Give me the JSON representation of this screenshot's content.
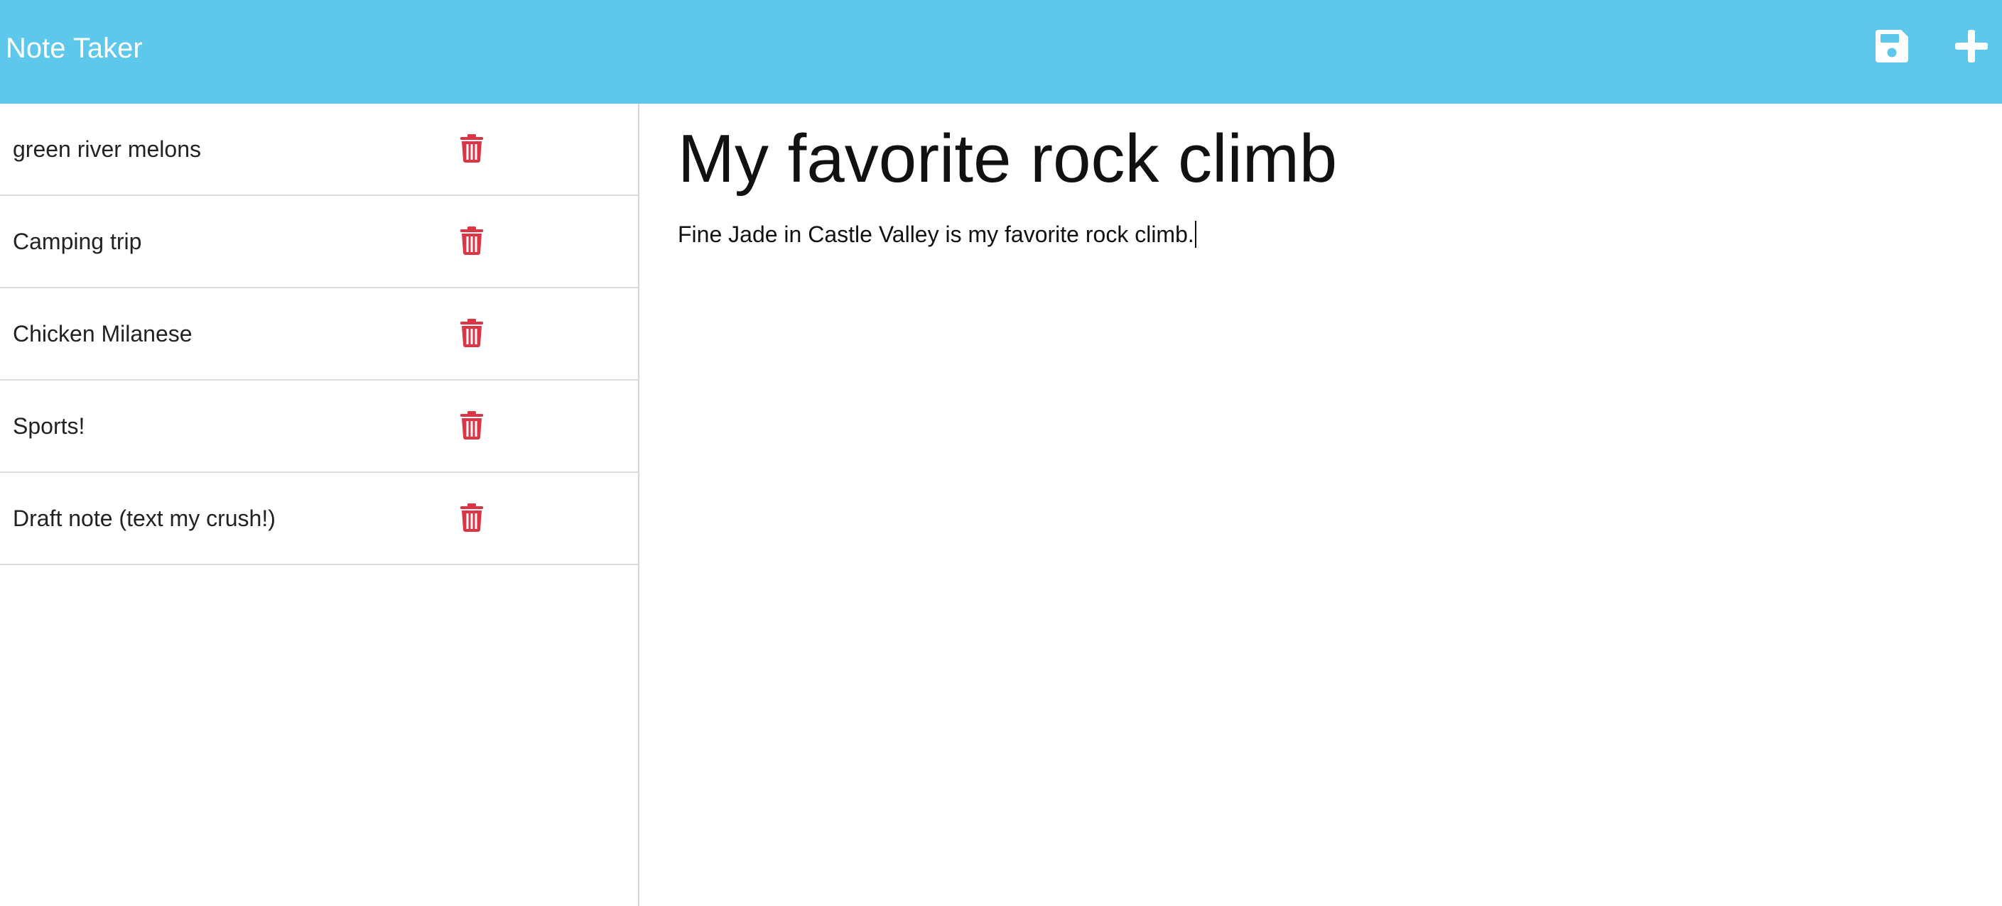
{
  "app": {
    "brand": "Note Taker"
  },
  "toolbar": {
    "save_icon": "floppy-disk-icon",
    "new_icon": "plus-icon",
    "icon_color": "#ffffff"
  },
  "colors": {
    "navbar": "#5ec8ec",
    "delete": "#dc3545"
  },
  "sidebar": {
    "notes": [
      {
        "title": "green river melons",
        "icon": "trash-icon"
      },
      {
        "title": "Camping trip",
        "icon": "trash-icon"
      },
      {
        "title": "Chicken Milanese",
        "icon": "trash-icon"
      },
      {
        "title": "Sports!",
        "icon": "trash-icon"
      },
      {
        "title": "Draft note (text my crush!)",
        "icon": "trash-icon"
      }
    ]
  },
  "editor": {
    "title": "My favorite rock climb",
    "body": "Fine Jade in Castle Valley is my favorite rock climb."
  }
}
